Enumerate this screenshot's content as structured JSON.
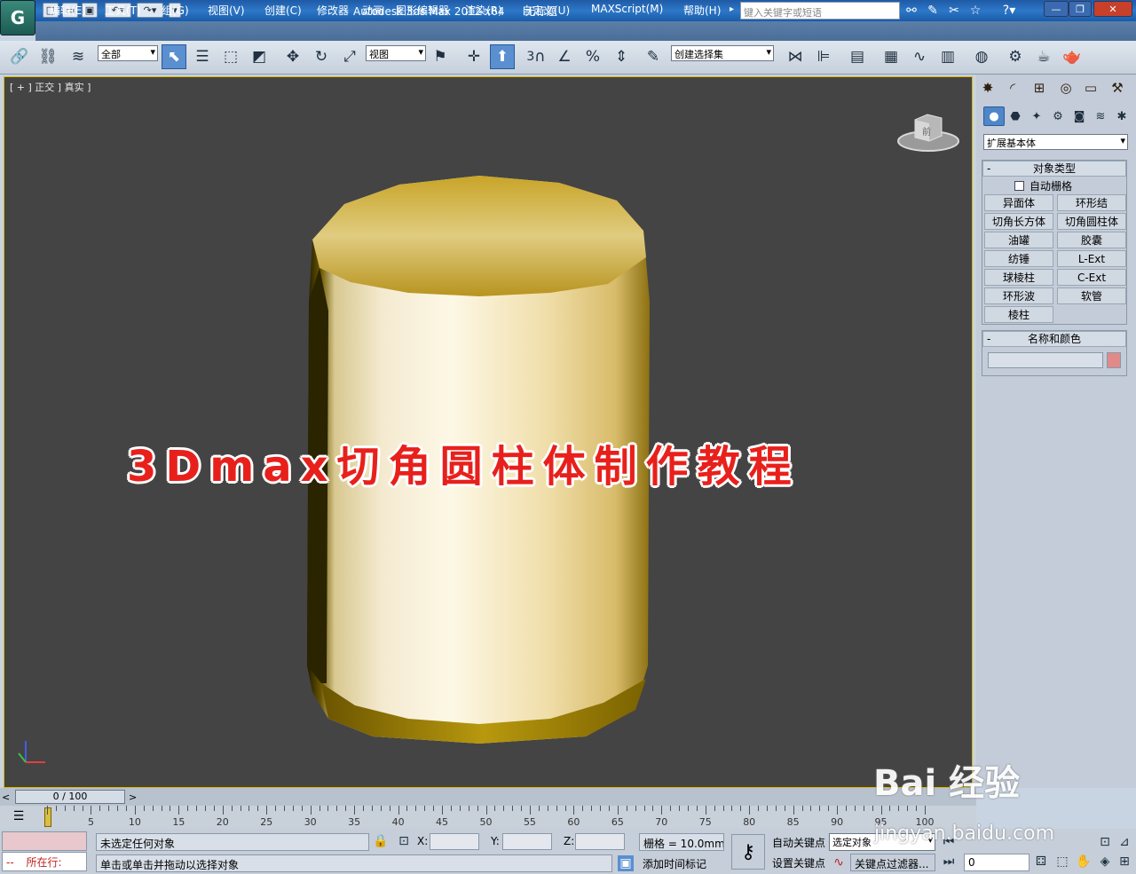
{
  "window": {
    "title": "Autodesk 3ds Max  2012 x64",
    "doc_title": "无标题",
    "search_placeholder": "键入关键字或短语"
  },
  "menu": [
    "编辑(E)",
    "工具(T)",
    "组(G)",
    "视图(V)",
    "创建(C)",
    "修改器",
    "动画",
    "图形编辑器",
    "渲染(R)",
    "自定义(U)",
    "MAXScript(M)",
    "帮助(H)"
  ],
  "toolbar": {
    "selection_filter": "全部",
    "ref_coord": "视图",
    "named_selection": "创建选择集",
    "snap_label": "3"
  },
  "viewport": {
    "label": "[ + ] 正交 ] 真实 ]",
    "viewcube_face": "前",
    "overlay_title": "3Dmax切角圆柱体制作教程",
    "object_color": "#e6d08a"
  },
  "command_panel": {
    "category": "扩展基本体",
    "object_type_header": "对象类型",
    "autogrid": "自动栅格",
    "buttons": [
      "异面体",
      "环形结",
      "切角长方体",
      "切角圆柱体",
      "油罐",
      "胶囊",
      "纺锤",
      "L-Ext",
      "球棱柱",
      "C-Ext",
      "环形波",
      "软管",
      "棱柱"
    ],
    "name_color_header": "名称和颜色",
    "object_name": "",
    "swatch_color": "#e08a8a"
  },
  "timeline": {
    "position": "0 / 100",
    "ticks": [
      "5",
      "10",
      "15",
      "20",
      "25",
      "30",
      "35",
      "40",
      "45",
      "50",
      "55",
      "60",
      "65",
      "70",
      "75",
      "80",
      "85",
      "90",
      "95",
      "100"
    ]
  },
  "status": {
    "maxscript_label": "所在行:",
    "selection": "未选定任何对象",
    "prompt": "单击或单击并拖动以选择对象",
    "x_label": "X:",
    "y_label": "Y:",
    "z_label": "Z:",
    "grid": "栅格 = 10.0mm",
    "add_time_tag": "添加时间标记",
    "auto_key": "自动关键点",
    "set_key": "设置关键点",
    "key_mode": "选定对象",
    "key_filters": "关键点过滤器...",
    "frame": "0"
  },
  "watermark": {
    "brand": "Bai 经验",
    "url": "jingyan.baidu.com"
  }
}
